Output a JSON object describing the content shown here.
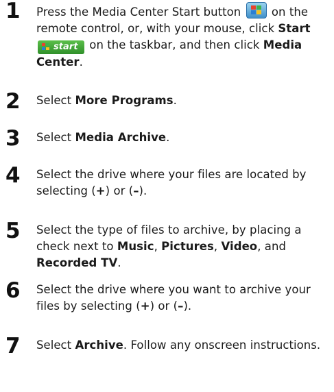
{
  "steps": [
    {
      "n": "1",
      "parts": [
        {
          "t": "Press the Media Center Start button "
        },
        {
          "icon": "windows-flag-icon"
        },
        {
          "t": " on the remote control, or, with your mouse, click "
        },
        {
          "b": "Start"
        },
        {
          "t": " "
        },
        {
          "icon": "start-button-icon"
        },
        {
          "t": " on the taskbar, and then click "
        },
        {
          "b": "Media Center"
        },
        {
          "t": "."
        }
      ]
    },
    {
      "n": "2",
      "parts": [
        {
          "t": "Select "
        },
        {
          "b": "More Programs"
        },
        {
          "t": "."
        }
      ]
    },
    {
      "n": "3",
      "parts": [
        {
          "t": "Select "
        },
        {
          "b": "Media Archive"
        },
        {
          "t": "."
        }
      ]
    },
    {
      "n": "4",
      "parts": [
        {
          "t": "Select the drive where your files are located by selecting ("
        },
        {
          "b": "+"
        },
        {
          "t": ") or ("
        },
        {
          "b": "–"
        },
        {
          "t": ")."
        }
      ]
    },
    {
      "n": "5",
      "parts": [
        {
          "t": "Select the type of files to archive, by placing a check next to "
        },
        {
          "b": "Music"
        },
        {
          "t": ", "
        },
        {
          "b": "Pictures"
        },
        {
          "t": ", "
        },
        {
          "b": "Video"
        },
        {
          "t": ", and "
        },
        {
          "b": "Recorded TV"
        },
        {
          "t": "."
        }
      ]
    },
    {
      "n": "6",
      "parts": [
        {
          "t": "Select the drive where you want to archive your files by selecting ("
        },
        {
          "b": "+"
        },
        {
          "t": ") or ("
        },
        {
          "b": "–"
        },
        {
          "t": ")."
        }
      ]
    },
    {
      "n": "7",
      "parts": [
        {
          "t": "Select "
        },
        {
          "b": "Archive"
        },
        {
          "t": ". Follow any onscreen instructions."
        }
      ]
    }
  ],
  "start_button_label": "start",
  "flag_colors": [
    "#e8432e",
    "#3fb34a",
    "#2a7fd4",
    "#f5c320"
  ]
}
